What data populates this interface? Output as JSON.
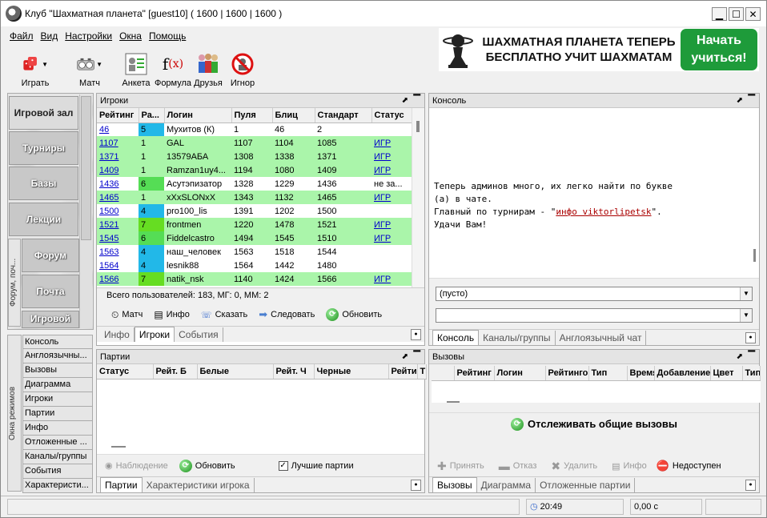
{
  "window": {
    "title": "Клуб \"Шахматная планета\" [guest10]  ( 1600 | 1600 | 1600 )"
  },
  "menu": [
    "Файл",
    "Вид",
    "Настройки",
    "Окна",
    "Помощь"
  ],
  "toolbar": [
    {
      "label": "Играть",
      "icon": "dice-icon"
    },
    {
      "label": "Матч",
      "icon": "chess-clock-icon"
    },
    {
      "label": "Анкета",
      "icon": "profile-card-icon"
    },
    {
      "label": "Формула",
      "icon": "formula-icon"
    },
    {
      "label": "Друзья",
      "icon": "friends-icon"
    },
    {
      "label": "Игнор",
      "icon": "ignore-icon"
    }
  ],
  "ad": {
    "line1": "ШАХМАТНАЯ ПЛАНЕТА ТЕПЕРЬ",
    "line2": "БЕСПЛАТНО УЧИТ ШАХМАТАМ",
    "button": "Начать учиться!"
  },
  "nav": [
    "Игровой зал",
    "Турниры",
    "Базы",
    "Лекции",
    "Форум",
    "Почта",
    "Игровой"
  ],
  "nav_side_label": "Форум, поч...",
  "modes": [
    "Консоль",
    "Англоязычны...",
    "Вызовы",
    "Диаграмма",
    "Игроки",
    "Партии",
    "Инфо",
    "Отложенные ...",
    "Каналы/группы",
    "События",
    "Характеристи..."
  ],
  "modes_side_label": "Окна режимов",
  "players": {
    "title": "Игроки",
    "columns": [
      "Рейтинг",
      "Ра...",
      "Логин",
      "Пуля",
      "Блиц",
      "Стандарт",
      "Статус"
    ],
    "rows": [
      {
        "rating": "46",
        "rank": "5",
        "login": "Мухитов (К)",
        "bullet": "1",
        "blitz": "46",
        "standard": "2",
        "status": "",
        "rank_color": "#22b8e8",
        "row_color": "#ffffff"
      },
      {
        "rating": "1107",
        "rank": "1",
        "login": "GAL",
        "bullet": "1107",
        "blitz": "1104",
        "standard": "1085",
        "status": "ИГР",
        "rank_color": "",
        "row_color": "#aaf5aa"
      },
      {
        "rating": "1371",
        "rank": "1",
        "login": "13579АБА",
        "bullet": "1308",
        "blitz": "1338",
        "standard": "1371",
        "status": "ИГР",
        "rank_color": "",
        "row_color": "#aaf5aa"
      },
      {
        "rating": "1409",
        "rank": "1",
        "login": "Ramzan1uy4...",
        "bullet": "1194",
        "blitz": "1080",
        "standard": "1409",
        "status": "ИГР",
        "rank_color": "",
        "row_color": "#aaf5aa"
      },
      {
        "rating": "1436",
        "rank": "6",
        "login": "Асутэпизатор",
        "bullet": "1328",
        "blitz": "1229",
        "standard": "1436",
        "status": "не за...",
        "rank_color": "#55dd55",
        "row_color": "#ffffff"
      },
      {
        "rating": "1465",
        "rank": "1",
        "login": "xXxSLONxX",
        "bullet": "1343",
        "blitz": "1132",
        "standard": "1465",
        "status": "ИГР",
        "rank_color": "",
        "row_color": "#aaf5aa"
      },
      {
        "rating": "1500",
        "rank": "4",
        "login": "pro100_lis",
        "bullet": "1391",
        "blitz": "1202",
        "standard": "1500",
        "status": "",
        "rank_color": "#22b8e8",
        "row_color": "#ffffff"
      },
      {
        "rating": "1521",
        "rank": "7",
        "login": "frontmen",
        "bullet": "1220",
        "blitz": "1478",
        "standard": "1521",
        "status": "ИГР",
        "rank_color": "#66dd22",
        "row_color": "#aaf5aa"
      },
      {
        "rating": "1545",
        "rank": "6",
        "login": "Fiddelcastro",
        "bullet": "1494",
        "blitz": "1545",
        "standard": "1510",
        "status": "ИГР",
        "rank_color": "#55dd55",
        "row_color": "#aaf5aa"
      },
      {
        "rating": "1563",
        "rank": "4",
        "login": "наш_человек",
        "bullet": "1563",
        "blitz": "1518",
        "standard": "1544",
        "status": "",
        "rank_color": "#22b8e8",
        "row_color": "#ffffff"
      },
      {
        "rating": "1564",
        "rank": "4",
        "login": "lesnik88",
        "bullet": "1564",
        "blitz": "1442",
        "standard": "1480",
        "status": "",
        "rank_color": "#22b8e8",
        "row_color": "#ffffff"
      },
      {
        "rating": "1566",
        "rank": "7",
        "login": "natik_nsk",
        "bullet": "1140",
        "blitz": "1424",
        "standard": "1566",
        "status": "ИГР",
        "rank_color": "#66dd22",
        "row_color": "#aaf5aa"
      }
    ],
    "summary": "Всего пользователей: 183, МГ: 0, ММ: 2",
    "buttons": [
      {
        "label": "Матч",
        "icon": "chess-clock-icon"
      },
      {
        "label": "Инфо",
        "icon": "info-card-icon"
      },
      {
        "label": "Сказать",
        "icon": "speech-icon"
      },
      {
        "label": "Следовать",
        "icon": "arrow-right-icon"
      },
      {
        "label": "Обновить",
        "icon": "refresh-icon"
      }
    ],
    "tabs": [
      "Инфо",
      "Игроки",
      "События"
    ],
    "active_tab": "Игроки"
  },
  "console": {
    "title": "Консоль",
    "lines": [
      "Теперь админов много, их легко найти по букве",
      "(а) в чате."
    ],
    "line3_prefix": "Главный по турнирам - \"",
    "line3_link": "инфо viktorlipetsk",
    "line3_suffix": "\".",
    "line4": "Удачи Вам!",
    "combo1": "(пусто)",
    "combo2": "",
    "tabs": [
      "Консоль",
      "Каналы/группы",
      "Англоязычный чат"
    ],
    "active_tab": "Консоль"
  },
  "games": {
    "title": "Партии",
    "columns": [
      "Статус",
      "Рейт. Б",
      "Белые",
      "Рейт. Ч",
      "Черные",
      "Рейти",
      "Т"
    ],
    "buttons": [
      {
        "label": "Наблюдение",
        "icon": "eye-icon",
        "enabled": false
      },
      {
        "label": "Обновить",
        "icon": "refresh-icon",
        "enabled": true
      }
    ],
    "best_games_label": "Лучшие партии",
    "best_games_checked": true,
    "tabs": [
      "Партии",
      "Характеристики игрока"
    ],
    "active_tab": "Партии"
  },
  "challenges": {
    "title": "Вызовы",
    "columns": [
      "Рейтинг",
      "Логин",
      "Рейтинго",
      "Тип",
      "Время",
      "Добавление",
      "Цвет",
      "Тип"
    ],
    "track_label": "Отслеживать общие вызовы",
    "buttons": [
      {
        "label": "Принять",
        "icon": "plus-icon",
        "enabled": false
      },
      {
        "label": "Отказ",
        "icon": "minus-icon",
        "enabled": false
      },
      {
        "label": "Удалить",
        "icon": "delete-icon",
        "enabled": false
      },
      {
        "label": "Инфо",
        "icon": "info-card-icon",
        "enabled": false
      },
      {
        "label": "Недоступен",
        "icon": "not-available-icon",
        "enabled": true
      }
    ],
    "tabs": [
      "Вызовы",
      "Диаграмма",
      "Отложенные партии"
    ],
    "active_tab": "Вызовы"
  },
  "statusbar": {
    "time": "20:49",
    "timer": "0,00 с"
  },
  "colors": {
    "green_row": "#aaf5aa",
    "link": "#0000cc",
    "ad_button": "#1e9b3a"
  }
}
